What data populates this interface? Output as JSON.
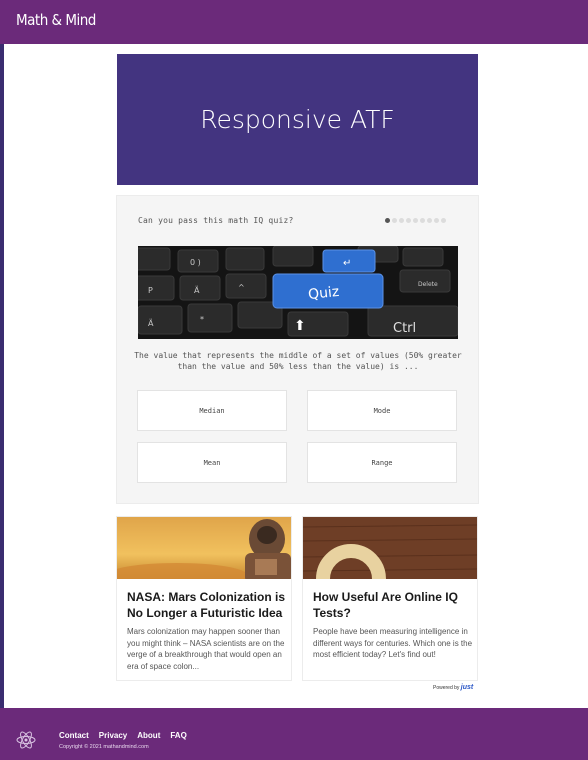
{
  "header": {
    "logo": "Math & Mind"
  },
  "ad": {
    "label": "Responsive ATF"
  },
  "quiz": {
    "title": "Can you pass this math IQ quiz?",
    "progress": {
      "current": 1,
      "total": 9
    },
    "image_keys": {
      "quiz_key": "Quiz",
      "ctrl_key": "Ctrl"
    },
    "question": "The value that represents the middle of a set of values (50% greater than the value and 50% less than the value) is ...",
    "answers": [
      "Median",
      "Mode",
      "Mean",
      "Range"
    ]
  },
  "articles": [
    {
      "title": "NASA: Mars Colonization is No Longer a Futuristic Idea",
      "excerpt": "Mars colonization may happen sooner than you might think – NASA scientists are on the verge of a breakthrough that would open an era of space colon..."
    },
    {
      "title": "How Useful Are Online IQ Tests?",
      "excerpt": "People have been measuring intelligence in different ways for centuries. Which one is the most efficient today? Let's find out!"
    }
  ],
  "powered": {
    "label": "Powered by",
    "brand": "just"
  },
  "footer": {
    "links": [
      "Contact",
      "Privacy",
      "About",
      "FAQ"
    ],
    "copyright": "Copyright © 2021 mathandmind.com"
  },
  "colors": {
    "header_bg": "#6b2a7a",
    "ad_bg": "#433480",
    "key_blue": "#2f6fd0"
  }
}
